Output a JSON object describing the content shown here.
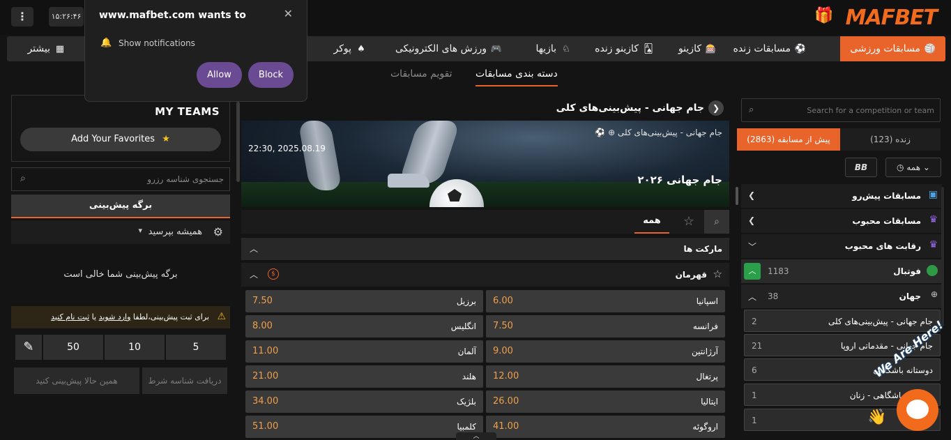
{
  "topbar": {
    "menu_icon": "⋮",
    "clock": "۱۵:۲۶:۴۶",
    "logo": "MAFBET",
    "gift_icon": "gift-icon"
  },
  "nav": {
    "items": [
      {
        "label": "مسابقات ورزشی",
        "icon": "🏐"
      },
      {
        "label": "مسابقات زنده",
        "icon": "⚽"
      },
      {
        "label": "کازینو",
        "icon": "🎰"
      },
      {
        "label": "کازینو زنده",
        "icon": "🂡"
      },
      {
        "label": "بازیها",
        "icon": "♘"
      },
      {
        "label": "ورزش های الکترونیکی",
        "icon": "🎮"
      },
      {
        "label": "پوکر",
        "icon": "♠"
      },
      {
        "label": "بیشتر",
        "icon": "▦"
      }
    ]
  },
  "subnav": {
    "active": "دسته بندی مسابقات",
    "inactive": "تقویم مسابقات"
  },
  "notification": {
    "title": "www.mafbet.com wants to",
    "text": "Show notifications",
    "allow": "Allow",
    "block": "Block",
    "close": "✕"
  },
  "left": {
    "my_teams": "MY TEAMS",
    "add_favorites": "Add Your Favorites",
    "search_placeholder": "جستجوی شناسه رزرو",
    "betslip_tab": "برگه پیش‌بینی",
    "always_ask": "همیشه بپرسید",
    "empty": "برگه پیش‌بینی شما خالی است",
    "warn_prefix": "برای ثبت پیش‌بینی،لطفا",
    "warn_login": "وارد شوید",
    "warn_or": "یا",
    "warn_register": "ثبت نام کنید",
    "stakes": [
      "5",
      "10",
      "50"
    ],
    "edit_icon": "✎",
    "get_code": "دریافت شناسه شرط",
    "bet_now": "همین حالا پیش‌بینی کنید"
  },
  "center": {
    "competition_title": "جام جهانی - پیش‌بینی‌های کلی",
    "banner": {
      "date": "22:30, 2025.08.19",
      "subtitle": "جام جهانی - پیش‌بینی‌های کلی",
      "title": "جام جهانی ۲۰۲۶"
    },
    "filter_all": "همه",
    "markets": "مارکت ها",
    "winner": "قهرمان",
    "coin_symbol": "$",
    "odds": [
      {
        "name": "اسپانیا",
        "price": "6.00"
      },
      {
        "name": "برزیل",
        "price": "7.50"
      },
      {
        "name": "فرانسه",
        "price": "7.50"
      },
      {
        "name": "انگلیس",
        "price": "8.00"
      },
      {
        "name": "آرژانتین",
        "price": "9.00"
      },
      {
        "name": "آلمان",
        "price": "11.00"
      },
      {
        "name": "پرتغال",
        "price": "12.00"
      },
      {
        "name": "هلند",
        "price": "21.00"
      },
      {
        "name": "ایتالیا",
        "price": "26.00"
      },
      {
        "name": "بلژیک",
        "price": "34.00"
      },
      {
        "name": "اروگوئه",
        "price": "41.00"
      },
      {
        "name": "کلمبیا",
        "price": "51.00"
      }
    ]
  },
  "right": {
    "search_placeholder": "Search for a competition or team",
    "live": "زنده (123)",
    "prematch": "پیش از مسابقه (2863)",
    "all": "همه",
    "bb": "BB",
    "rows": [
      {
        "label": "مسابقات پیش‌رو"
      },
      {
        "label": "مسابقات محبوب"
      },
      {
        "label": "رقابت های محبوب"
      }
    ],
    "sport": {
      "label": "فوتبال",
      "count": "1183"
    },
    "region": {
      "label": "جهان",
      "count": "38"
    },
    "competitions": [
      {
        "label": "جام جهانی - پیش‌بینی‌های کلی",
        "count": "2"
      },
      {
        "label": "جام جهانی - مقدماتی اروپا",
        "count": "21"
      },
      {
        "label": "دوستانه باشگاهی",
        "count": "6"
      },
      {
        "label": "دوستانه باشگاهی - زنان",
        "count": "1"
      },
      {
        "label": "",
        "count": "1"
      }
    ],
    "chat_badge": "We Are Here!"
  }
}
